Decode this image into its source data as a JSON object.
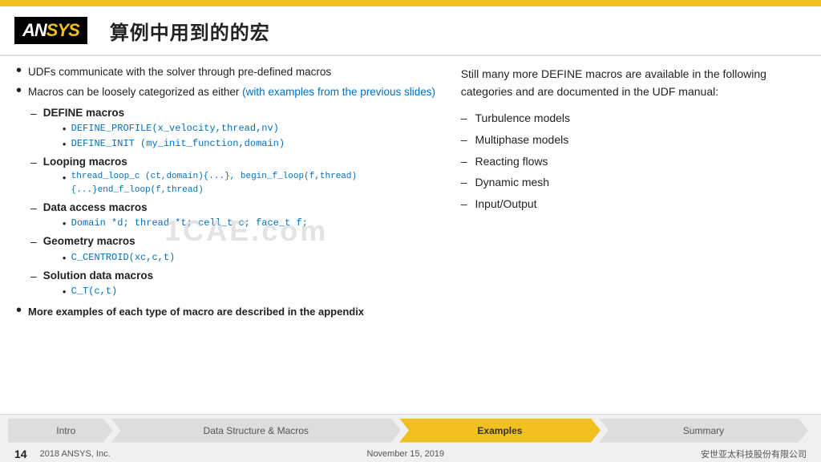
{
  "topBar": {
    "color": "#f0c020"
  },
  "header": {
    "logo": {
      "an": "AN",
      "sys": "SYS"
    },
    "title": "算例中用到的的宏"
  },
  "left": {
    "bullets": [
      {
        "text": "UDFs communicate with the solver through pre-defined macros"
      },
      {
        "text_plain": "Macros can be loosely categorized as either ",
        "text_blue": "(with examples from the previous slides)"
      }
    ],
    "subGroups": [
      {
        "label": "DEFINE macros",
        "children": [
          "DEFINE_PROFILE(x_velocity,thread,nv)",
          "DEFINE_INIT (my_init_function,domain)"
        ]
      },
      {
        "label": "Looping macros",
        "children": [
          "thread_loop_c (ct,domain){...}, begin_f_loop(f,thread){...}end_f_loop(f,thread)"
        ]
      },
      {
        "label": "Data access macros",
        "children": [
          "Domain *d; thread *t; cell_t c; face_t f;"
        ]
      },
      {
        "label": "Geometry macros",
        "children": [
          "C_CENTROID(xc,c,t)"
        ]
      },
      {
        "label": "Solution data macros",
        "children": [
          "C_T(c,t)"
        ]
      }
    ],
    "lastBullet": "More examples of each type of macro are described in the appendix"
  },
  "right": {
    "introText": "Still many more DEFINE macros are available in the following categories  and are documented in the UDF manual:",
    "items": [
      "Turbulence models",
      "Multiphase models",
      "Reacting flows",
      "Dynamic mesh",
      "Input/Output"
    ]
  },
  "nav": {
    "segments": [
      {
        "label": "Intro",
        "active": false
      },
      {
        "label": "Data Structure & Macros",
        "active": false
      },
      {
        "label": "Examples",
        "active": true
      },
      {
        "label": "Summary",
        "active": false
      }
    ],
    "pageNum": "14",
    "footerLeft": "2018  ANSYS, Inc.",
    "footerMiddle": "November 15, 2019",
    "footerRight": "安世亚太科技股份有限公司"
  },
  "watermark": "1CAE.com"
}
